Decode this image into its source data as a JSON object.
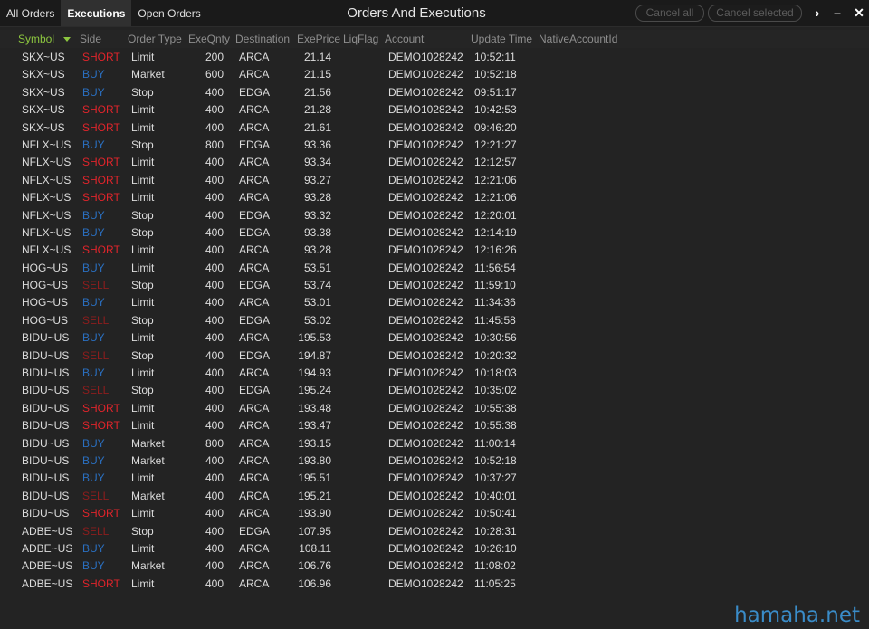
{
  "tabs": [
    "All Orders",
    "Executions",
    "Open Orders"
  ],
  "active_tab": 1,
  "window_title": "Orders And Executions",
  "buttons": {
    "cancel_all": "Cancel all",
    "cancel_selected": "Cancel selected"
  },
  "controls": {
    "more": "›",
    "minimize": "–",
    "close": "✕"
  },
  "columns": [
    "Symbol",
    "Side",
    "Order Type",
    "ExeQnty",
    "Destination",
    "ExePrice",
    "LiqFlag",
    "Account",
    "Update Time",
    "NativeAccountId"
  ],
  "sorted_column": "Symbol",
  "colors": {
    "short": "#e0242b",
    "buy": "#2a6fc0",
    "sell": "#8e1d1d",
    "sorted_header": "#8cc63f"
  },
  "rows": [
    {
      "symbol": "SKX~US",
      "side": "SHORT",
      "order_type": "Limit",
      "qty": "200",
      "dest": "ARCA",
      "price": "21.14",
      "liq": "",
      "account": "DEMO1028242",
      "time": "10:52:11"
    },
    {
      "symbol": "SKX~US",
      "side": "BUY",
      "order_type": "Market",
      "qty": "600",
      "dest": "ARCA",
      "price": "21.15",
      "liq": "",
      "account": "DEMO1028242",
      "time": "10:52:18"
    },
    {
      "symbol": "SKX~US",
      "side": "BUY",
      "order_type": "Stop",
      "qty": "400",
      "dest": "EDGA",
      "price": "21.56",
      "liq": "",
      "account": "DEMO1028242",
      "time": "09:51:17"
    },
    {
      "symbol": "SKX~US",
      "side": "SHORT",
      "order_type": "Limit",
      "qty": "400",
      "dest": "ARCA",
      "price": "21.28",
      "liq": "",
      "account": "DEMO1028242",
      "time": "10:42:53"
    },
    {
      "symbol": "SKX~US",
      "side": "SHORT",
      "order_type": "Limit",
      "qty": "400",
      "dest": "ARCA",
      "price": "21.61",
      "liq": "",
      "account": "DEMO1028242",
      "time": "09:46:20"
    },
    {
      "symbol": "NFLX~US",
      "side": "BUY",
      "order_type": "Stop",
      "qty": "800",
      "dest": "EDGA",
      "price": "93.36",
      "liq": "",
      "account": "DEMO1028242",
      "time": "12:21:27"
    },
    {
      "symbol": "NFLX~US",
      "side": "SHORT",
      "order_type": "Limit",
      "qty": "400",
      "dest": "ARCA",
      "price": "93.34",
      "liq": "",
      "account": "DEMO1028242",
      "time": "12:12:57"
    },
    {
      "symbol": "NFLX~US",
      "side": "SHORT",
      "order_type": "Limit",
      "qty": "400",
      "dest": "ARCA",
      "price": "93.27",
      "liq": "",
      "account": "DEMO1028242",
      "time": "12:21:06"
    },
    {
      "symbol": "NFLX~US",
      "side": "SHORT",
      "order_type": "Limit",
      "qty": "400",
      "dest": "ARCA",
      "price": "93.28",
      "liq": "",
      "account": "DEMO1028242",
      "time": "12:21:06"
    },
    {
      "symbol": "NFLX~US",
      "side": "BUY",
      "order_type": "Stop",
      "qty": "400",
      "dest": "EDGA",
      "price": "93.32",
      "liq": "",
      "account": "DEMO1028242",
      "time": "12:20:01"
    },
    {
      "symbol": "NFLX~US",
      "side": "BUY",
      "order_type": "Stop",
      "qty": "400",
      "dest": "EDGA",
      "price": "93.38",
      "liq": "",
      "account": "DEMO1028242",
      "time": "12:14:19"
    },
    {
      "symbol": "NFLX~US",
      "side": "SHORT",
      "order_type": "Limit",
      "qty": "400",
      "dest": "ARCA",
      "price": "93.28",
      "liq": "",
      "account": "DEMO1028242",
      "time": "12:16:26"
    },
    {
      "symbol": "HOG~US",
      "side": "BUY",
      "order_type": "Limit",
      "qty": "400",
      "dest": "ARCA",
      "price": "53.51",
      "liq": "",
      "account": "DEMO1028242",
      "time": "11:56:54"
    },
    {
      "symbol": "HOG~US",
      "side": "SELL",
      "order_type": "Stop",
      "qty": "400",
      "dest": "EDGA",
      "price": "53.74",
      "liq": "",
      "account": "DEMO1028242",
      "time": "11:59:10"
    },
    {
      "symbol": "HOG~US",
      "side": "BUY",
      "order_type": "Limit",
      "qty": "400",
      "dest": "ARCA",
      "price": "53.01",
      "liq": "",
      "account": "DEMO1028242",
      "time": "11:34:36"
    },
    {
      "symbol": "HOG~US",
      "side": "SELL",
      "order_type": "Stop",
      "qty": "400",
      "dest": "EDGA",
      "price": "53.02",
      "liq": "",
      "account": "DEMO1028242",
      "time": "11:45:58"
    },
    {
      "symbol": "BIDU~US",
      "side": "BUY",
      "order_type": "Limit",
      "qty": "400",
      "dest": "ARCA",
      "price": "195.53",
      "liq": "",
      "account": "DEMO1028242",
      "time": "10:30:56"
    },
    {
      "symbol": "BIDU~US",
      "side": "SELL",
      "order_type": "Stop",
      "qty": "400",
      "dest": "EDGA",
      "price": "194.87",
      "liq": "",
      "account": "DEMO1028242",
      "time": "10:20:32"
    },
    {
      "symbol": "BIDU~US",
      "side": "BUY",
      "order_type": "Limit",
      "qty": "400",
      "dest": "ARCA",
      "price": "194.93",
      "liq": "",
      "account": "DEMO1028242",
      "time": "10:18:03"
    },
    {
      "symbol": "BIDU~US",
      "side": "SELL",
      "order_type": "Stop",
      "qty": "400",
      "dest": "EDGA",
      "price": "195.24",
      "liq": "",
      "account": "DEMO1028242",
      "time": "10:35:02"
    },
    {
      "symbol": "BIDU~US",
      "side": "SHORT",
      "order_type": "Limit",
      "qty": "400",
      "dest": "ARCA",
      "price": "193.48",
      "liq": "",
      "account": "DEMO1028242",
      "time": "10:55:38"
    },
    {
      "symbol": "BIDU~US",
      "side": "SHORT",
      "order_type": "Limit",
      "qty": "400",
      "dest": "ARCA",
      "price": "193.47",
      "liq": "",
      "account": "DEMO1028242",
      "time": "10:55:38"
    },
    {
      "symbol": "BIDU~US",
      "side": "BUY",
      "order_type": "Market",
      "qty": "800",
      "dest": "ARCA",
      "price": "193.15",
      "liq": "",
      "account": "DEMO1028242",
      "time": "11:00:14"
    },
    {
      "symbol": "BIDU~US",
      "side": "BUY",
      "order_type": "Market",
      "qty": "400",
      "dest": "ARCA",
      "price": "193.80",
      "liq": "",
      "account": "DEMO1028242",
      "time": "10:52:18"
    },
    {
      "symbol": "BIDU~US",
      "side": "BUY",
      "order_type": "Limit",
      "qty": "400",
      "dest": "ARCA",
      "price": "195.51",
      "liq": "",
      "account": "DEMO1028242",
      "time": "10:37:27"
    },
    {
      "symbol": "BIDU~US",
      "side": "SELL",
      "order_type": "Market",
      "qty": "400",
      "dest": "ARCA",
      "price": "195.21",
      "liq": "",
      "account": "DEMO1028242",
      "time": "10:40:01"
    },
    {
      "symbol": "BIDU~US",
      "side": "SHORT",
      "order_type": "Limit",
      "qty": "400",
      "dest": "ARCA",
      "price": "193.90",
      "liq": "",
      "account": "DEMO1028242",
      "time": "10:50:41"
    },
    {
      "symbol": "ADBE~US",
      "side": "SELL",
      "order_type": "Stop",
      "qty": "400",
      "dest": "EDGA",
      "price": "107.95",
      "liq": "",
      "account": "DEMO1028242",
      "time": "10:28:31"
    },
    {
      "symbol": "ADBE~US",
      "side": "BUY",
      "order_type": "Limit",
      "qty": "400",
      "dest": "ARCA",
      "price": "108.11",
      "liq": "",
      "account": "DEMO1028242",
      "time": "10:26:10"
    },
    {
      "symbol": "ADBE~US",
      "side": "BUY",
      "order_type": "Market",
      "qty": "400",
      "dest": "ARCA",
      "price": "106.76",
      "liq": "",
      "account": "DEMO1028242",
      "time": "11:08:02"
    },
    {
      "symbol": "ADBE~US",
      "side": "SHORT",
      "order_type": "Limit",
      "qty": "400",
      "dest": "ARCA",
      "price": "106.96",
      "liq": "",
      "account": "DEMO1028242",
      "time": "11:05:25"
    }
  ],
  "watermark": "hamaha.net"
}
